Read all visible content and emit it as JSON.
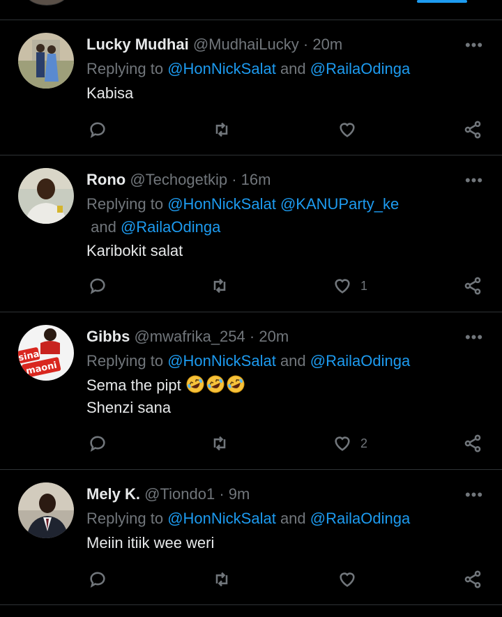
{
  "replying_prefix": "Replying to",
  "more_glyph": "•••",
  "colors": {
    "background": "#000000",
    "text": "#e7e9ea",
    "muted": "#71767b",
    "link": "#1d9bf0",
    "divider": "#2f3336"
  },
  "tweets": [
    {
      "name": "Lucky Mudhai",
      "handle": "@MudhaiLucky",
      "sep": "·",
      "time": "20m",
      "reply_to": [
        "@HonNickSalat",
        "@RailaOdinga"
      ],
      "reply_joiners": [
        " and "
      ],
      "text": "Kabisa",
      "likes": "",
      "avatar_icon": "couple-photo-avatar"
    },
    {
      "name": "Rono",
      "handle": "@Techogetkip",
      "sep": "·",
      "time": "16m",
      "reply_to": [
        "@HonNickSalat",
        "@KANUParty_ke",
        "@RailaOdinga"
      ],
      "reply_joiners": [
        " ",
        " and "
      ],
      "text": "Karibokit salat",
      "likes": "1",
      "avatar_icon": "man-photo-avatar"
    },
    {
      "name": "Gibbs",
      "handle": "@mwafrika_254",
      "sep": "·",
      "time": "20m",
      "reply_to": [
        "@HonNickSalat",
        "@RailaOdinga"
      ],
      "reply_joiners": [
        " and "
      ],
      "text_line1": "Sema the pipt",
      "text_line2": "Shenzi sana",
      "emoji_icon": "rolling-on-floor-laughing-emoji",
      "emoji_count": 3,
      "avatar_text_1": "sina",
      "avatar_text_2": "maoni",
      "likes": "2",
      "avatar_icon": "sina-maoni-logo-avatar"
    },
    {
      "name": "Mely K.",
      "handle": "@Tiondo1",
      "sep": "·",
      "time": "9m",
      "reply_to": [
        "@HonNickSalat",
        "@RailaOdinga"
      ],
      "reply_joiners": [
        " and "
      ],
      "text": "Meiin itiik wee weri",
      "likes": "",
      "avatar_icon": "suited-man-photo-avatar"
    }
  ]
}
